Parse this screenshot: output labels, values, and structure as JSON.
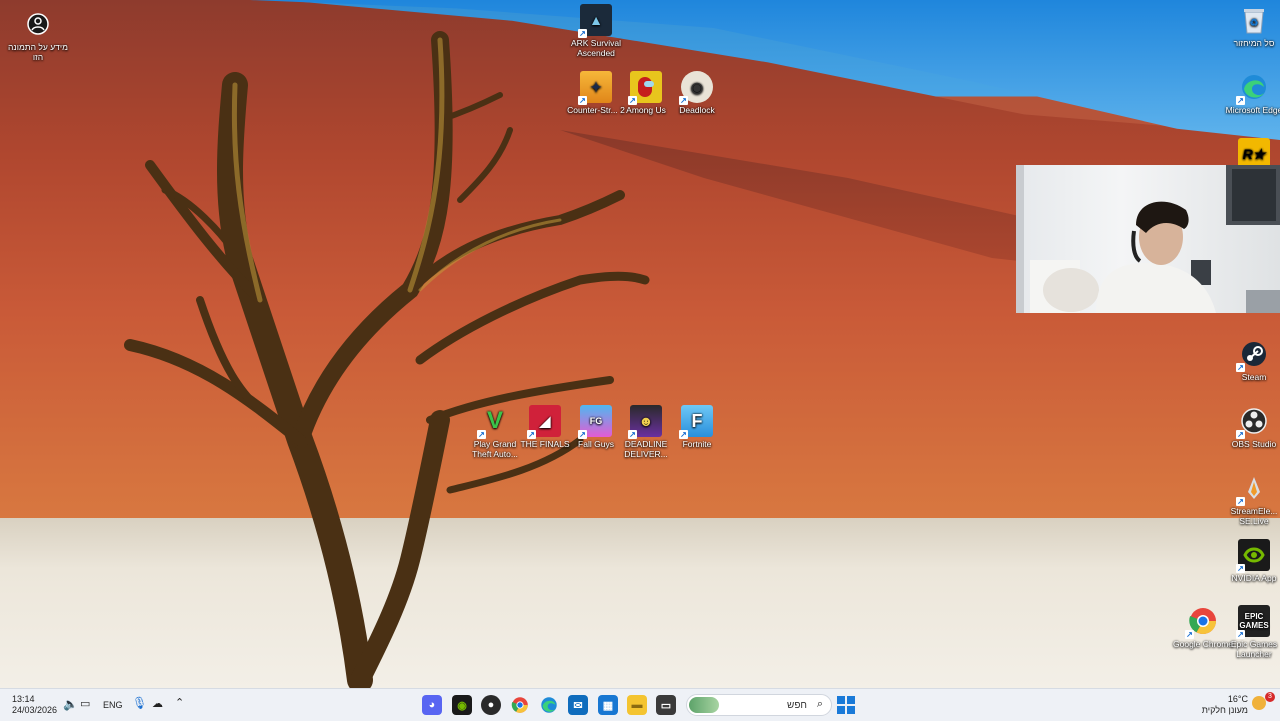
{
  "desktop": {
    "image_info": {
      "label": "מידע על התמונה הזו",
      "icon": "info-circle-icon"
    },
    "icons_top": [
      {
        "label": "ARK Survival Ascended",
        "icon": "ark-icon",
        "color": "#1b2a3a"
      },
      {
        "label": "Counter-Str... 2",
        "icon": "cs2-icon",
        "color": "#f0a01e"
      },
      {
        "label": "Among Us",
        "icon": "among-us-icon",
        "color": "#c51d1d"
      },
      {
        "label": "Deadlock",
        "icon": "deadlock-icon",
        "color": "#e9e3d6"
      }
    ],
    "icons_middle": [
      {
        "label": "Play Grand Theft Auto...",
        "icon": "gta-icon",
        "color": "#1a7a2a"
      },
      {
        "label": "THE FINALS",
        "icon": "the-finals-icon",
        "color": "#d0213a"
      },
      {
        "label": "Fall Guys",
        "icon": "fall-guys-icon",
        "color": "#7a4bd3"
      },
      {
        "label": "DEADLINE DELIVER...",
        "icon": "deadline-icon",
        "color": "#5b2a8a"
      },
      {
        "label": "Fortnite",
        "icon": "fortnite-icon",
        "color": "#3aa0e8"
      }
    ],
    "icons_right": [
      {
        "label": "סל המיחזור",
        "icon": "recycle-bin-icon",
        "color": "#e9eef4"
      },
      {
        "label": "Microsoft Edge",
        "icon": "edge-icon",
        "color": "#1f8bd8"
      },
      {
        "label": "",
        "icon": "rockstar-icon",
        "color": "#f2b800"
      },
      {
        "label": "Steam",
        "icon": "steam-icon",
        "color": "#1b2838"
      },
      {
        "label": "OBS Studio",
        "icon": "obs-icon",
        "color": "#2a2a2a"
      },
      {
        "label": "StreamEle... SE.Live",
        "icon": "streamelements-icon",
        "color": "#cfd6dd"
      },
      {
        "label": "NVIDIA App",
        "icon": "nvidia-icon",
        "color": "#76b900"
      },
      {
        "label": "Google Chrome",
        "icon": "chrome-icon",
        "color": "#ffffff"
      },
      {
        "label": "Epic Games Launcher",
        "icon": "epic-games-icon",
        "color": "#222222"
      }
    ]
  },
  "taskbar": {
    "time": "13:14",
    "date": "24/03/2026",
    "language": "ENG",
    "search_placeholder": "חפש",
    "weather_temp": "16°C",
    "weather_desc": "מעונן חלקית",
    "notification_count": "3",
    "apps": [
      {
        "icon": "discord-icon",
        "color": "#5865f2"
      },
      {
        "icon": "nvidia-icon",
        "color": "#76b900"
      },
      {
        "icon": "obs-icon",
        "color": "#2a2a2a"
      },
      {
        "icon": "chrome-icon",
        "color": "#e8453c"
      },
      {
        "icon": "edge-icon",
        "color": "#1f8bd8"
      },
      {
        "icon": "outlook-icon",
        "color": "#0f6cbd"
      },
      {
        "icon": "store-icon",
        "color": "#1877d2"
      },
      {
        "icon": "file-explorer-icon",
        "color": "#f4c430"
      },
      {
        "icon": "terminal-icon",
        "color": "#3a3a3a"
      }
    ]
  }
}
